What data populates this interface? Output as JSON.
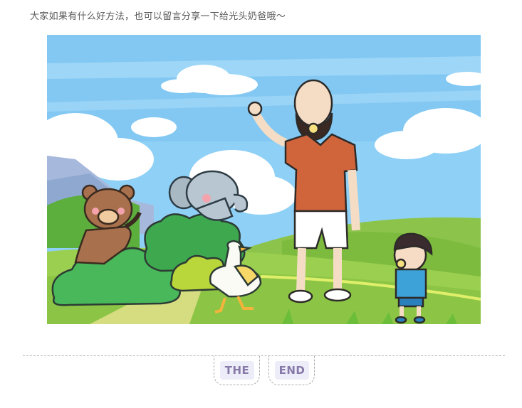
{
  "article": {
    "intro_text": "大家如果有什么好方法，也可以留言分享一下给光头奶爸哦～"
  },
  "ending": {
    "word1": "THE",
    "word2": "END"
  },
  "colors": {
    "text": "#5a5a5a",
    "end_text": "#8779a8",
    "end_pill": "#ecedf8",
    "divider": "#b9b9b9"
  },
  "illustration_items": [
    "cartoon-bald-dad",
    "cartoon-boy",
    "cartoon-bear",
    "cartoon-elephant",
    "cartoon-duck",
    "bush",
    "cloud",
    "hill"
  ]
}
